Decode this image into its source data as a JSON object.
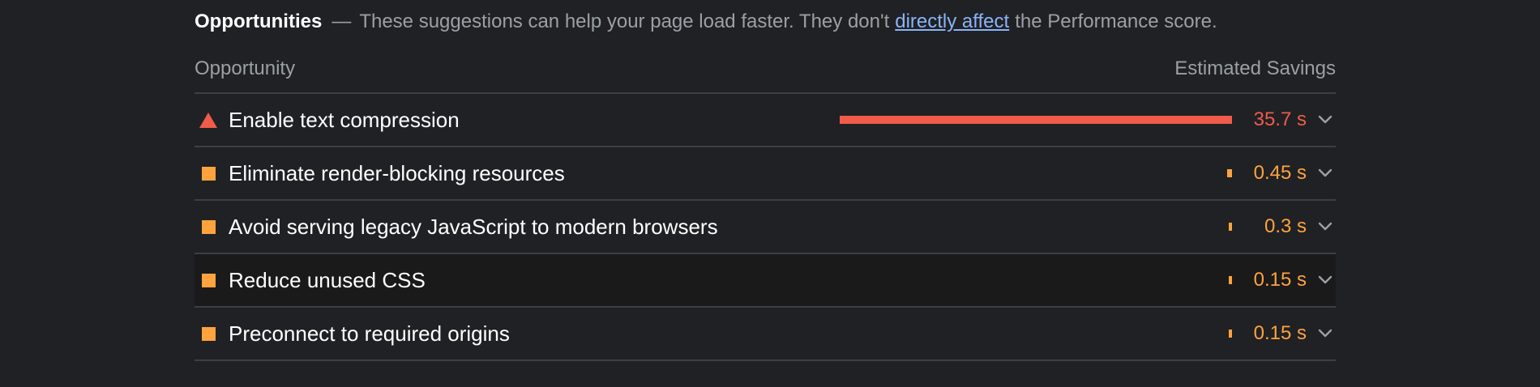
{
  "header": {
    "title": "Opportunities",
    "separator": "—",
    "desc_before": "These suggestions can help your page load faster. They don't",
    "link": "directly affect",
    "desc_after": "the Performance score."
  },
  "columns": {
    "left": "Opportunity",
    "right": "Estimated Savings"
  },
  "max_savings_s": 35.7,
  "opportunities": [
    {
      "label": "Enable text compression",
      "savings": "35.7 s",
      "savings_s": 35.7,
      "rating": "fail",
      "icon": "triangle-warning-icon"
    },
    {
      "label": "Eliminate render-blocking resources",
      "savings": "0.45 s",
      "savings_s": 0.45,
      "rating": "average",
      "icon": "square-average-icon"
    },
    {
      "label": "Avoid serving legacy JavaScript to modern browsers",
      "savings": "0.3 s",
      "savings_s": 0.3,
      "rating": "average",
      "icon": "square-average-icon"
    },
    {
      "label": "Reduce unused CSS",
      "savings": "0.15 s",
      "savings_s": 0.15,
      "rating": "average",
      "icon": "square-average-icon"
    },
    {
      "label": "Preconnect to required origins",
      "savings": "0.15 s",
      "savings_s": 0.15,
      "rating": "average",
      "icon": "square-average-icon"
    }
  ],
  "colors": {
    "fail": "#f05b4a",
    "average": "#ffa33e",
    "link": "#8ab4f8",
    "background": "#202124"
  }
}
